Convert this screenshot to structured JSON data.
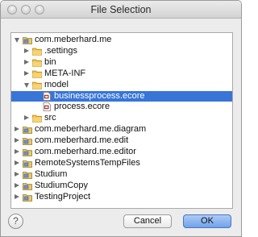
{
  "window": {
    "title": "File Selection"
  },
  "tree": {
    "items": [
      {
        "label": "com.meberhard.me",
        "type": "project",
        "expanded": true,
        "depth": 0,
        "selected": false
      },
      {
        "label": ".settings",
        "type": "folder",
        "expanded": false,
        "depth": 1,
        "selected": false
      },
      {
        "label": "bin",
        "type": "folder",
        "expanded": false,
        "depth": 1,
        "selected": false
      },
      {
        "label": "META-INF",
        "type": "folder",
        "expanded": false,
        "depth": 1,
        "selected": false
      },
      {
        "label": "model",
        "type": "folder",
        "expanded": true,
        "depth": 1,
        "selected": false
      },
      {
        "label": "businessprocess.ecore",
        "type": "file",
        "depth": 2,
        "selected": true
      },
      {
        "label": "process.ecore",
        "type": "file",
        "depth": 2,
        "selected": false
      },
      {
        "label": "src",
        "type": "folder",
        "expanded": false,
        "depth": 1,
        "selected": false
      },
      {
        "label": "com.meberhard.me.diagram",
        "type": "project",
        "expanded": false,
        "depth": 0,
        "selected": false
      },
      {
        "label": "com.meberhard.me.edit",
        "type": "project",
        "expanded": false,
        "depth": 0,
        "selected": false
      },
      {
        "label": "com.meberhard.me.editor",
        "type": "project",
        "expanded": false,
        "depth": 0,
        "selected": false
      },
      {
        "label": "RemoteSystemsTempFiles",
        "type": "project",
        "expanded": false,
        "depth": 0,
        "selected": false
      },
      {
        "label": "Studium",
        "type": "project",
        "expanded": false,
        "depth": 0,
        "selected": false
      },
      {
        "label": "StudiumCopy",
        "type": "project",
        "expanded": false,
        "depth": 0,
        "selected": false
      },
      {
        "label": "TestingProject",
        "type": "project",
        "expanded": false,
        "depth": 0,
        "selected": false
      }
    ]
  },
  "footer": {
    "help_label": "?",
    "cancel_label": "Cancel",
    "ok_label": "OK"
  },
  "colors": {
    "selection": "#3875d7",
    "folder": "#f0c24b",
    "ok_button": "#6fa2ea"
  },
  "icons": {
    "project": "project-icon",
    "folder": "folder-icon",
    "file": "ecore-file-icon",
    "help": "help-icon"
  }
}
